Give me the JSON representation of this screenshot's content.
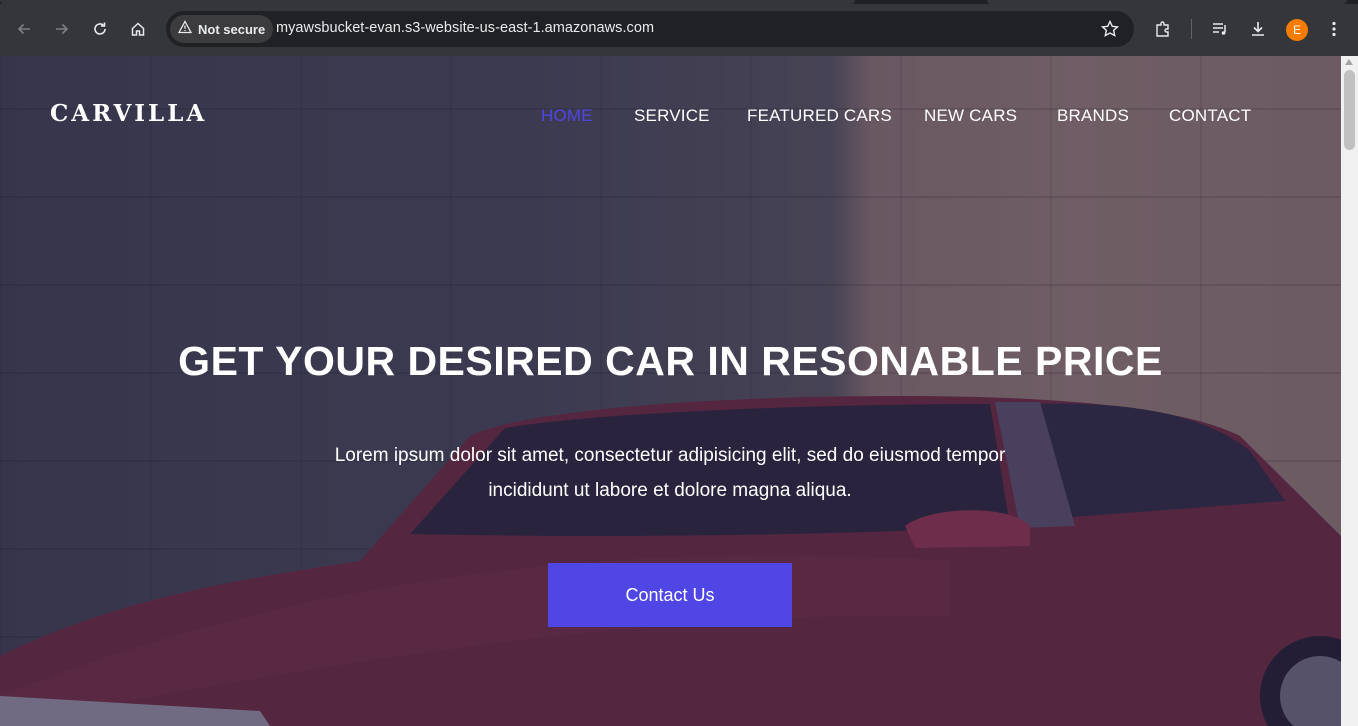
{
  "browser": {
    "security_label": "Not secure",
    "url": "myawsbucket-evan.s3-website-us-east-1.amazonaws.com",
    "profile_initial": "E",
    "profile_color": "#f57c00"
  },
  "site": {
    "logo": "CARVILLA",
    "nav": {
      "home": "HOME",
      "service": "SERVICE",
      "featured_cars": "FEATURED CARS",
      "new_cars": "NEW CARS",
      "brands": "BRANDS",
      "contact": "CONTACT"
    },
    "accent_color": "#4f46e5",
    "hero": {
      "title": "GET YOUR DESIRED CAR IN RESONABLE PRICE",
      "text_line1": "Lorem ipsum dolor sit amet, consectetur adipisicing elit, sed do eiusmod tempor",
      "text_line2": "incididunt ut labore et dolore magna aliqua.",
      "cta": "Contact Us"
    }
  }
}
